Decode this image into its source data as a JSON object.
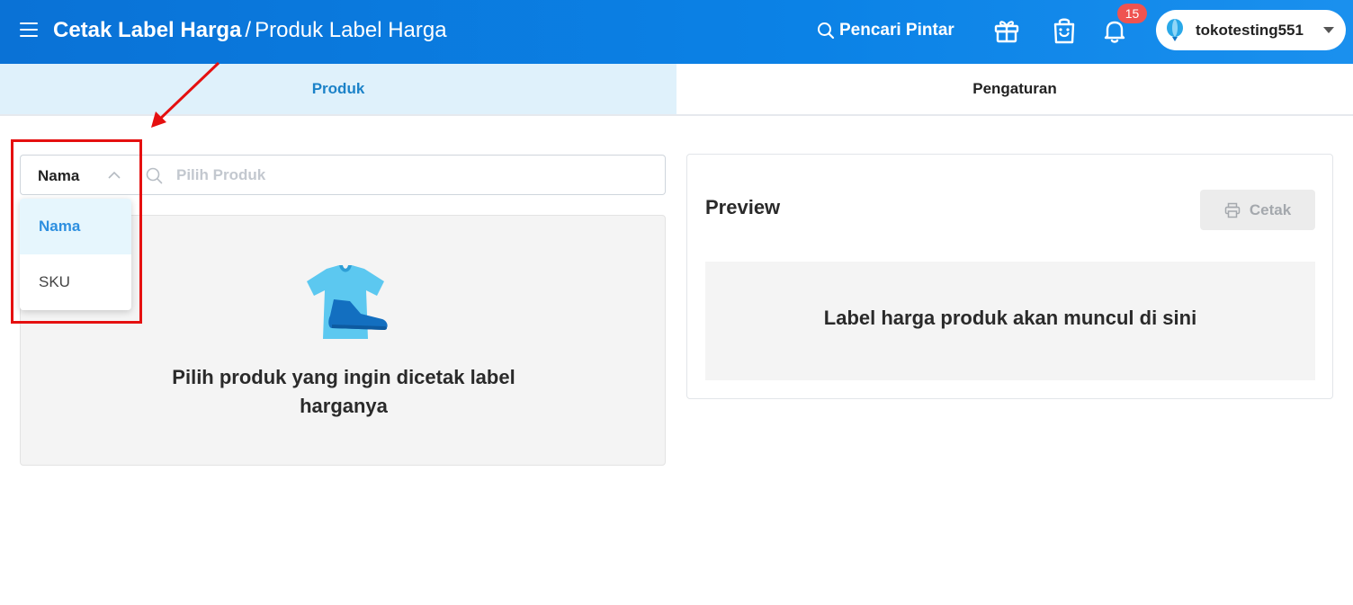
{
  "header": {
    "title_main": "Cetak Label Harga",
    "title_sep": "/",
    "title_sub": "Produk Label Harga",
    "smart_search_label": "Pencari Pintar",
    "notification_count": "15",
    "account_name": "tokotesting551"
  },
  "tabs": [
    {
      "label": "Produk",
      "active": true
    },
    {
      "label": "Pengaturan",
      "active": false
    }
  ],
  "search": {
    "filter_value": "Nama",
    "placeholder": "Pilih Produk",
    "options": [
      {
        "label": "Nama",
        "selected": true
      },
      {
        "label": "SKU",
        "selected": false
      }
    ]
  },
  "empty_state": {
    "message": "Pilih produk yang ingin dicetak label harganya"
  },
  "preview": {
    "title": "Preview",
    "print_label": "Cetak",
    "placeholder": "Label harga produk akan muncul di sini"
  },
  "colors": {
    "header_bg": "#0b82e6",
    "active_tab_bg": "#dff1fb",
    "active_tab_text": "#1b82c8",
    "badge": "#ef5350",
    "annotation_red": "#e51010"
  },
  "icons": {
    "menu": "hamburger-icon",
    "search": "search-icon",
    "gift": "gift-icon",
    "shop": "shopping-bag-icon",
    "bell": "bell-icon",
    "avatar": "balloon-icon",
    "print": "printer-icon"
  }
}
